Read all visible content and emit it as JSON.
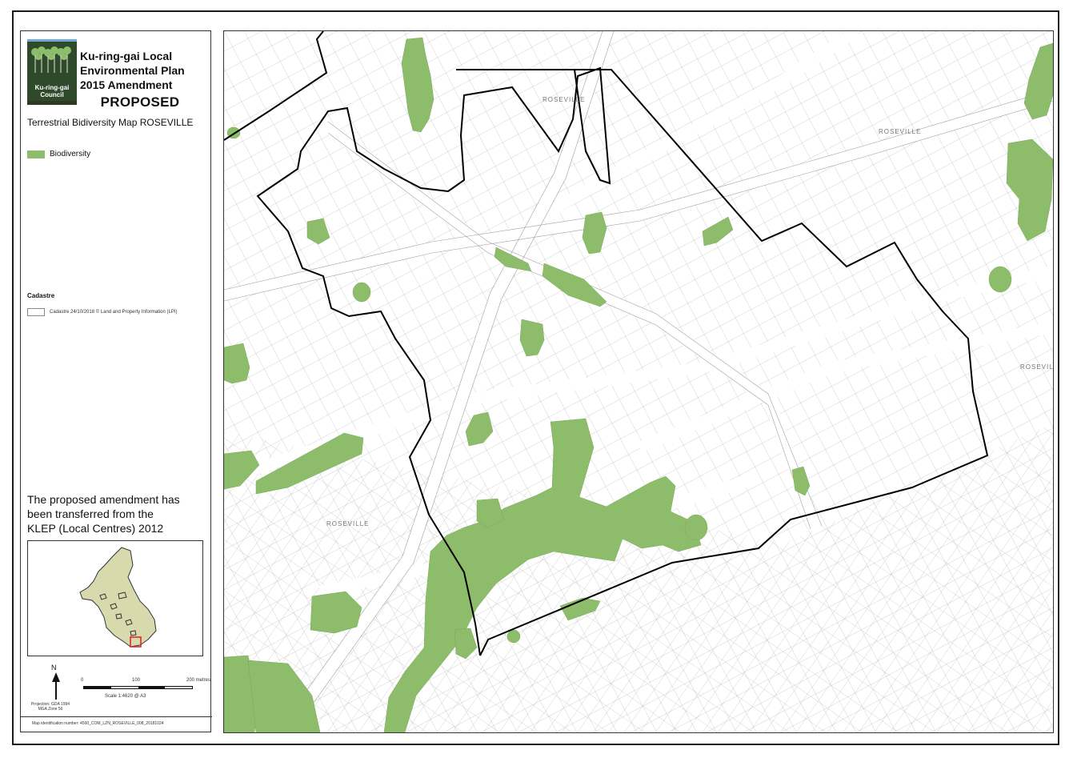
{
  "header": {
    "title_line1": "Ku-ring-gai Local",
    "title_line2": "Environmental Plan",
    "title_line3": "2015 Amendment",
    "status": "PROPOSED",
    "map_name": "Terrestrial Bidiversity Map ROSEVILLE"
  },
  "logo": {
    "line1": "Ku-ring-gai",
    "line2": "Council"
  },
  "legend": {
    "biodiversity_label": "Biodiversity",
    "biodiversity_color": "#8dbd6b",
    "cadastre_title": "Cadastre",
    "cadastre_label": "Cadastre 24/10/2018 © Land and Property Information (LPI)"
  },
  "note": {
    "line1": "The proposed amendment has",
    "line2": "been transferred from the",
    "line3": "KLEP (Local Centres) 2012"
  },
  "north_arrow": {
    "label": "N"
  },
  "projection": {
    "line1": "Projection: GDA 1994",
    "line2": "MGA Zone 56"
  },
  "scale": {
    "tick0": "0",
    "tick1": "100",
    "tick2": "200 metres",
    "text": "Scale 1:4620 @ A3"
  },
  "footer": {
    "map_id": "Map identification number: 4500_COM_LZN_ROSEVILLE_008_20181024"
  },
  "map": {
    "suburb_labels": [
      "ROSEVILLE",
      "ROSEVILLE",
      "ROSEVILLE",
      "ROSEVILLE"
    ],
    "boundary_color": "#000000",
    "cadastre_color": "#999999"
  }
}
